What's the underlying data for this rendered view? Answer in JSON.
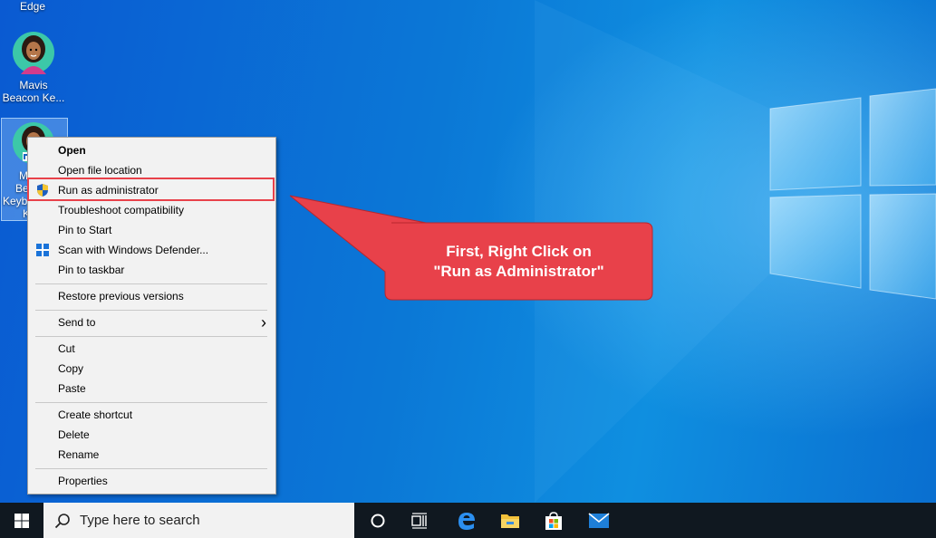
{
  "desktop": {
    "icons": [
      {
        "label": "Edge"
      },
      {
        "label_line1": "Mavis",
        "label_line2": "Beacon Ke..."
      },
      {
        "label_partial": [
          "M",
          "Be",
          "Keyb",
          "K"
        ]
      }
    ]
  },
  "context_menu": {
    "items": [
      {
        "label": "Open"
      },
      {
        "label": "Open file location"
      },
      {
        "label": "Run as administrator",
        "icon": "uac-shield-icon"
      },
      {
        "label": "Troubleshoot compatibility"
      },
      {
        "label": "Pin to Start"
      },
      {
        "label": "Scan with Windows Defender...",
        "icon": "defender-icon"
      },
      {
        "label": "Pin to taskbar"
      },
      {
        "label": "Restore previous versions"
      },
      {
        "label": "Send to",
        "submenu_arrow": "›"
      },
      {
        "label": "Cut"
      },
      {
        "label": "Copy"
      },
      {
        "label": "Paste"
      },
      {
        "label": "Create shortcut"
      },
      {
        "label": "Delete"
      },
      {
        "label": "Rename"
      },
      {
        "label": "Properties"
      }
    ]
  },
  "callout": {
    "line1": "First, Right Click on",
    "line2": "\"Run as Administrator\"",
    "color": "#e8414a"
  },
  "taskbar": {
    "search_placeholder": "Type here to search",
    "apps": [
      "cortana-icon",
      "task-view-icon",
      "edge-icon",
      "file-explorer-icon",
      "store-icon",
      "mail-icon"
    ]
  }
}
